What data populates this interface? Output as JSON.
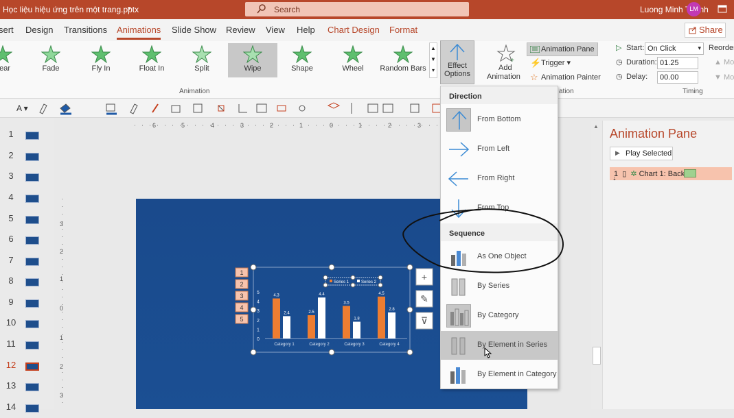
{
  "titlebar": {
    "filename": "Học liệu hiệu ứng trên một trang.pptx",
    "search_placeholder": "Search",
    "user": "Luong Minh Thanh",
    "avatar": "LM"
  },
  "tabs": [
    "sert",
    "Design",
    "Transitions",
    "Animations",
    "Slide Show",
    "Review",
    "View",
    "Help",
    "Chart Design",
    "Format"
  ],
  "share": "Share",
  "animations": [
    "pear",
    "Fade",
    "Fly In",
    "Float In",
    "Split",
    "Wipe",
    "Shape",
    "Wheel",
    "Random Bars"
  ],
  "ribbon": {
    "animation_group": "Animation",
    "effect_options": [
      "Effect",
      "Options"
    ],
    "add_animation": [
      "Add",
      "Animation"
    ],
    "animation_pane": "Animation Pane",
    "trigger": "Trigger",
    "animation_painter": "Animation Painter",
    "timing_group": "Timing",
    "start_label": "Start:",
    "start_value": "On Click",
    "duration_label": "Duration:",
    "duration_value": "01.25",
    "delay_label": "Delay:",
    "delay_value": "00.00",
    "reorder": "Reorder",
    "move1": "Mo",
    "move2": "Mo"
  },
  "menu": {
    "direction": "Direction",
    "dir_items": [
      "From Bottom",
      "From Left",
      "From Right",
      "From Top"
    ],
    "sequence": "Sequence",
    "seq_items": [
      "As One Object",
      "By Series",
      "By Category",
      "By Element in Series",
      "By Element in Category"
    ],
    "partial": "ation"
  },
  "slides": [
    "1",
    "2",
    "3",
    "4",
    "5",
    "6",
    "7",
    "8",
    "9",
    "10",
    "11",
    "12",
    "13",
    "14"
  ],
  "pane": {
    "title": "Animation Pane",
    "play": "Play Selected",
    "item_num": "1",
    "item_label": "Chart 1: Back..."
  },
  "chart_data": {
    "type": "bar",
    "categories": [
      "Category 1",
      "Category 2",
      "Category 3",
      "Category 4"
    ],
    "series": [
      {
        "name": "Series 1",
        "values": [
          4.3,
          2.5,
          3.5,
          4.5
        ]
      },
      {
        "name": "Series 2",
        "values": [
          2.4,
          4.4,
          1.8,
          2.8
        ]
      }
    ],
    "ylim": [
      0,
      5
    ],
    "yticks": [
      "0",
      "1",
      "2",
      "3",
      "4",
      "5"
    ],
    "legend": "top",
    "colors": [
      "#ed7d31",
      "#ffffff"
    ],
    "tags": [
      "1",
      "2",
      "3",
      "4",
      "5"
    ]
  }
}
